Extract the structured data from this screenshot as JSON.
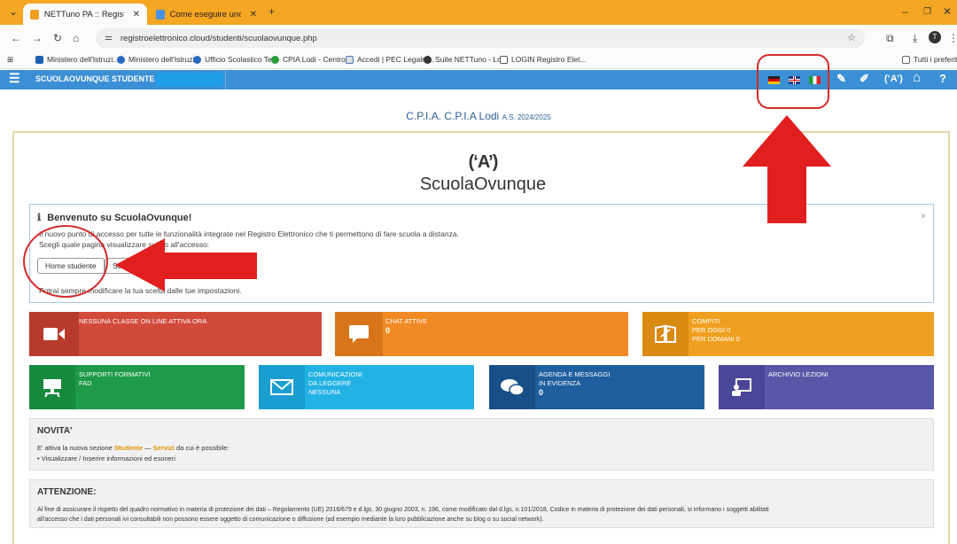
{
  "browser": {
    "tabs": [
      {
        "label": "NETTuno PA :: Registro Elettroni",
        "active": true
      },
      {
        "label": "Come eseguire uno screenshot",
        "active": false
      }
    ],
    "url": "registroelettronico.cloud/studenti/scuolaovunque.php",
    "bookmarks": [
      "Ministero dell'Istruzi...",
      "Ministero dell'Istruzi...",
      "Ufficio Scolastico Te...",
      "CPIA Lodi - Centro...",
      "Accedi | PEC Legalm...",
      "Suite NETTuno - Lo...",
      "LOGIN Registro Elet...",
      "Tutti i preferiti"
    ]
  },
  "appbar": {
    "menu1": "SCUOLAOVUNQUE",
    "menu2": "STUDENTE",
    "help": "?"
  },
  "school": {
    "name": "C.P.I.A. C.P.I.A Lodi",
    "year": "A.S. 2024/2025"
  },
  "logo": {
    "mark": "(‘A’)",
    "name": "ScuolaOvunque"
  },
  "welcome": {
    "title": "Benvenuto su ScuolaOvunque!",
    "line1": "Il nuovo punto di accesso per tutte le funzionalità integrate nel Registro Elettronico che ti permettono di fare scuola a distanza.",
    "line2": "Scegli quale pagina visualizzare subito all'accesso:",
    "btn_home": "Home studente",
    "btn_other": "ScuolaOvunque",
    "line3": "Potrai sempre modificare la tua scelta dalle tue impostazioni.",
    "close": "×"
  },
  "tiles": {
    "classi": "NESSUNA CLASSE ON LINE ATTIVA ORA",
    "chat_label": "CHAT ATTIVE",
    "chat_count": "0",
    "compiti_label": "COMPITI",
    "compiti_oggi": "PER OGGI 0",
    "compiti_domani": "PER DOMANI 0",
    "supporti_1": "SUPPORTI FORMATIVI",
    "supporti_2": "FAD",
    "comunicazioni_1": "COMUNICAZIONI",
    "comunicazioni_2": "DA LEGGERE",
    "comunicazioni_3": "NESSUNA",
    "agenda_1": "AGENDA E MESSAGGI",
    "agenda_2": "IN EVIDENZA",
    "agenda_count": "0",
    "archivio": "ARCHIVIO LEZIONI"
  },
  "novita": {
    "title": "NOVITA'",
    "prefix": "E' attiva la nuova sezione ",
    "hl1": "Studente",
    "sep": " — ",
    "hl2": "Servizi",
    "suffix": " da cui è possibile:",
    "bullet": "•  Visualizzare / Inserire informazioni ed esoneri"
  },
  "attenzione": {
    "title": "ATTENZIONE:",
    "line1": "Al fine di assicurare il rispetto del quadro normativo in materia di protezione dei dati – Regolamento (UE) 2016/679 e d.lgs. 30 giugno 2003, n. 196, come modificato dal d.lgs. n.101/2018, Codice in materia di protezione dei dati personali, si informano i soggetti abilitati",
    "line2": "all'accesso che i dati personali ivi consultabili non possono essere oggetto di comunicazione o diffusione (ad esempio mediante la loro pubblicazione anche su blog o su social network)."
  },
  "colors": {
    "tabbar": "#f5a623",
    "appbar": "#3b8fd4",
    "red_tile": "#d24a3a",
    "orange_tile": "#f08a24",
    "amber_tile": "#f0a020",
    "green_tile": "#1e9a4a",
    "cyan_tile": "#22b2e4",
    "navy_tile": "#1f5f9f",
    "purple_tile": "#5a56a8",
    "annotation": "#e11f1f"
  }
}
